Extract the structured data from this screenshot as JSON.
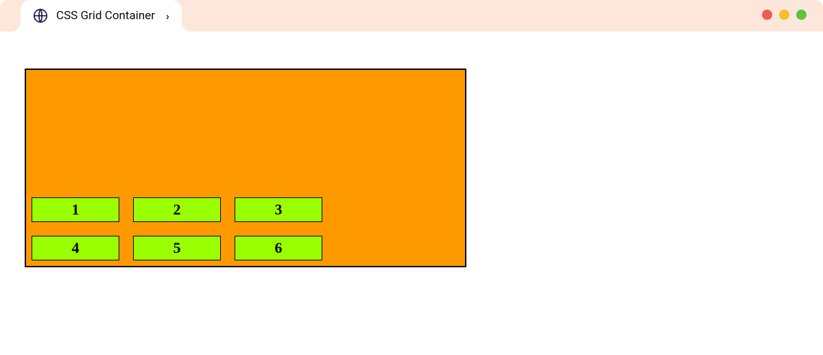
{
  "tab": {
    "title": "CSS Grid Container"
  },
  "grid": {
    "items": {
      "0": "1",
      "1": "2",
      "2": "3",
      "3": "4",
      "4": "5",
      "5": "6"
    }
  }
}
